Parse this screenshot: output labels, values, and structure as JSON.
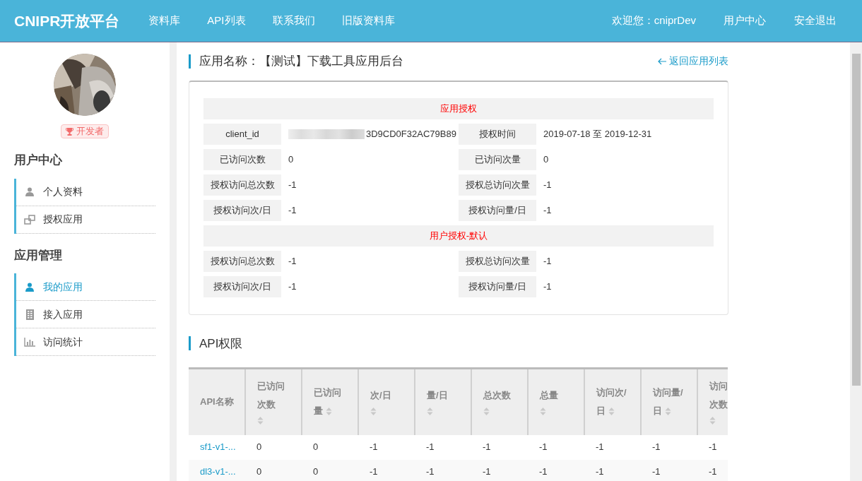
{
  "navbar": {
    "logo": "CNIPR开放平台",
    "links": [
      "资料库",
      "API列表",
      "联系我们",
      "旧版资料库"
    ],
    "welcome": "欢迎您：cniprDev",
    "user_links": [
      "用户中心",
      "安全退出"
    ]
  },
  "sidebar": {
    "badge": "开发者",
    "sections": [
      {
        "title": "用户中心",
        "items": [
          {
            "label": "个人资料",
            "selected": false
          },
          {
            "label": "授权应用",
            "selected": false
          }
        ]
      },
      {
        "title": "应用管理",
        "items": [
          {
            "label": "我的应用",
            "selected": true
          },
          {
            "label": "接入应用",
            "selected": false
          },
          {
            "label": "访问统计",
            "selected": false
          }
        ]
      }
    ]
  },
  "app_header": {
    "title": "应用名称：【测试】下载工具应用后台",
    "back_link": "返回应用列表"
  },
  "auth_panel": {
    "sections": [
      {
        "title": "应用授权",
        "rows": [
          [
            {
              "label": "client_id",
              "value": "3D9CD0F32AC79B89"
            },
            {
              "label": "授权时间",
              "value": "2019-07-18 至 2019-12-31"
            }
          ],
          [
            {
              "label": "已访问次数",
              "value": "0"
            },
            {
              "label": "已访问次量",
              "value": "0"
            }
          ],
          [
            {
              "label": "授权访问总次数",
              "value": "-1"
            },
            {
              "label": "授权总访问次量",
              "value": "-1"
            }
          ],
          [
            {
              "label": "授权访问次/日",
              "value": "-1"
            },
            {
              "label": "授权访问量/日",
              "value": "-1"
            }
          ]
        ]
      },
      {
        "title": "用户授权-默认",
        "rows": [
          [
            {
              "label": "授权访问总次数",
              "value": "-1"
            },
            {
              "label": "授权总访问次量",
              "value": "-1"
            }
          ],
          [
            {
              "label": "授权访问次/日",
              "value": "-1"
            },
            {
              "label": "授权访问量/日",
              "value": "-1"
            }
          ]
        ]
      }
    ]
  },
  "api_section": {
    "title": "API权限",
    "table": {
      "columns": [
        {
          "lines": [
            "API名称"
          ],
          "sortable": false
        },
        {
          "lines": [
            "已访问",
            "次数"
          ],
          "sortable": true
        },
        {
          "lines": [
            "已访问",
            "量"
          ],
          "sortable": true
        },
        {
          "lines": [
            "次/日"
          ],
          "sortable": true
        },
        {
          "lines": [
            "量/日"
          ],
          "sortable": true
        },
        {
          "lines": [
            "总次数"
          ],
          "sortable": true
        },
        {
          "lines": [
            "总量"
          ],
          "sortable": true
        },
        {
          "lines": [
            "访问次/",
            "日"
          ],
          "sortable": true
        },
        {
          "lines": [
            "访问量/",
            "日"
          ],
          "sortable": true
        },
        {
          "lines": [
            "访问",
            "次数"
          ],
          "sortable": true
        }
      ],
      "rows": [
        [
          "sf1-v1-...",
          "0",
          "0",
          "-1",
          "-1",
          "-1",
          "-1",
          "-1",
          "-1",
          "-1"
        ],
        [
          "dl3-v1-...",
          "0",
          "0",
          "-1",
          "-1",
          "-1",
          "-1",
          "-1",
          "-1",
          "-1"
        ]
      ]
    }
  }
}
